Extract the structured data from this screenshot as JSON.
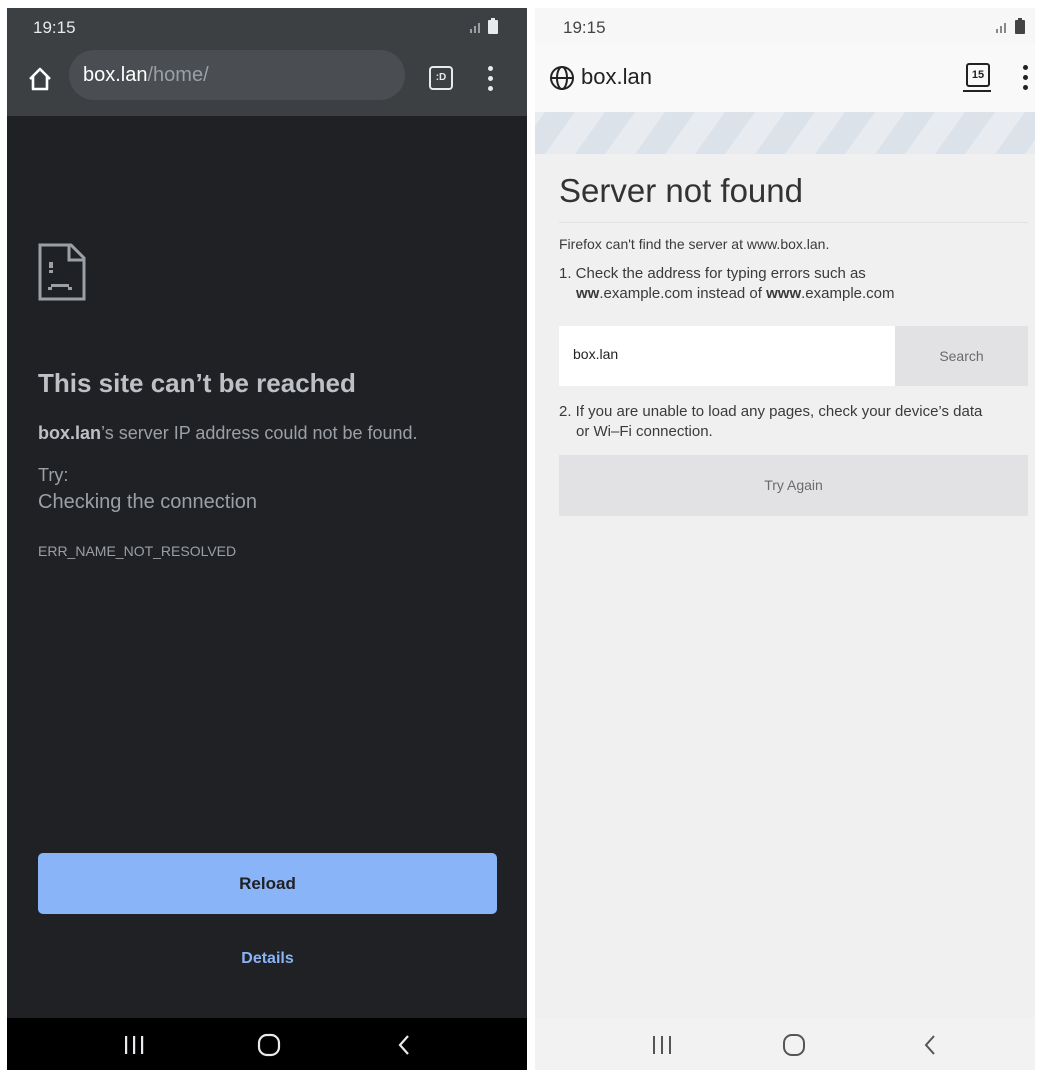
{
  "chrome": {
    "status_time": "19:15",
    "url_host": "box.lan",
    "url_path": "/home/",
    "tab_badge": ":D",
    "error_title": "This site can’t be reached",
    "desc_host": "box.lan",
    "desc_rest": "’s server IP address could not be found.",
    "try_label": "Try:",
    "suggestion": "Checking the connection",
    "error_code": "ERR_NAME_NOT_RESOLVED",
    "reload_label": "Reload",
    "details_label": "Details"
  },
  "firefox": {
    "status_time": "19:15",
    "url_host": "box.lan",
    "tab_count": "15",
    "heading": "Server not found",
    "intro": "Firefox can't find the server at www.box.lan.",
    "step1_line1": "1. Check the address for typing errors such as",
    "step1_ww": "ww",
    "step1_mid": ".example.com instead of ",
    "step1_www": "www",
    "step1_end": ".example.com",
    "search_value": "box.lan",
    "search_button": "Search",
    "step2_line1": "2. If you are unable to load any pages, check your device’s data",
    "step2_line2": "or Wi–Fi connection.",
    "try_again_label": "Try Again"
  },
  "icons": {
    "home": "home-icon",
    "tab_switcher": "tab-switcher-icon",
    "menu": "overflow-menu-icon",
    "sad_page": "sad-page-icon",
    "globe": "globe-icon",
    "recents": "recents-icon",
    "nav_home": "nav-home-icon",
    "back": "back-icon",
    "signal": "signal-icon",
    "battery": "battery-icon"
  },
  "colors": {
    "chrome_bg": "#202124",
    "chrome_toolbar": "#3c4043",
    "chrome_accent": "#8ab4f8",
    "firefox_bg": "#f0f0f0",
    "firefox_button": "#e2e2e4"
  }
}
